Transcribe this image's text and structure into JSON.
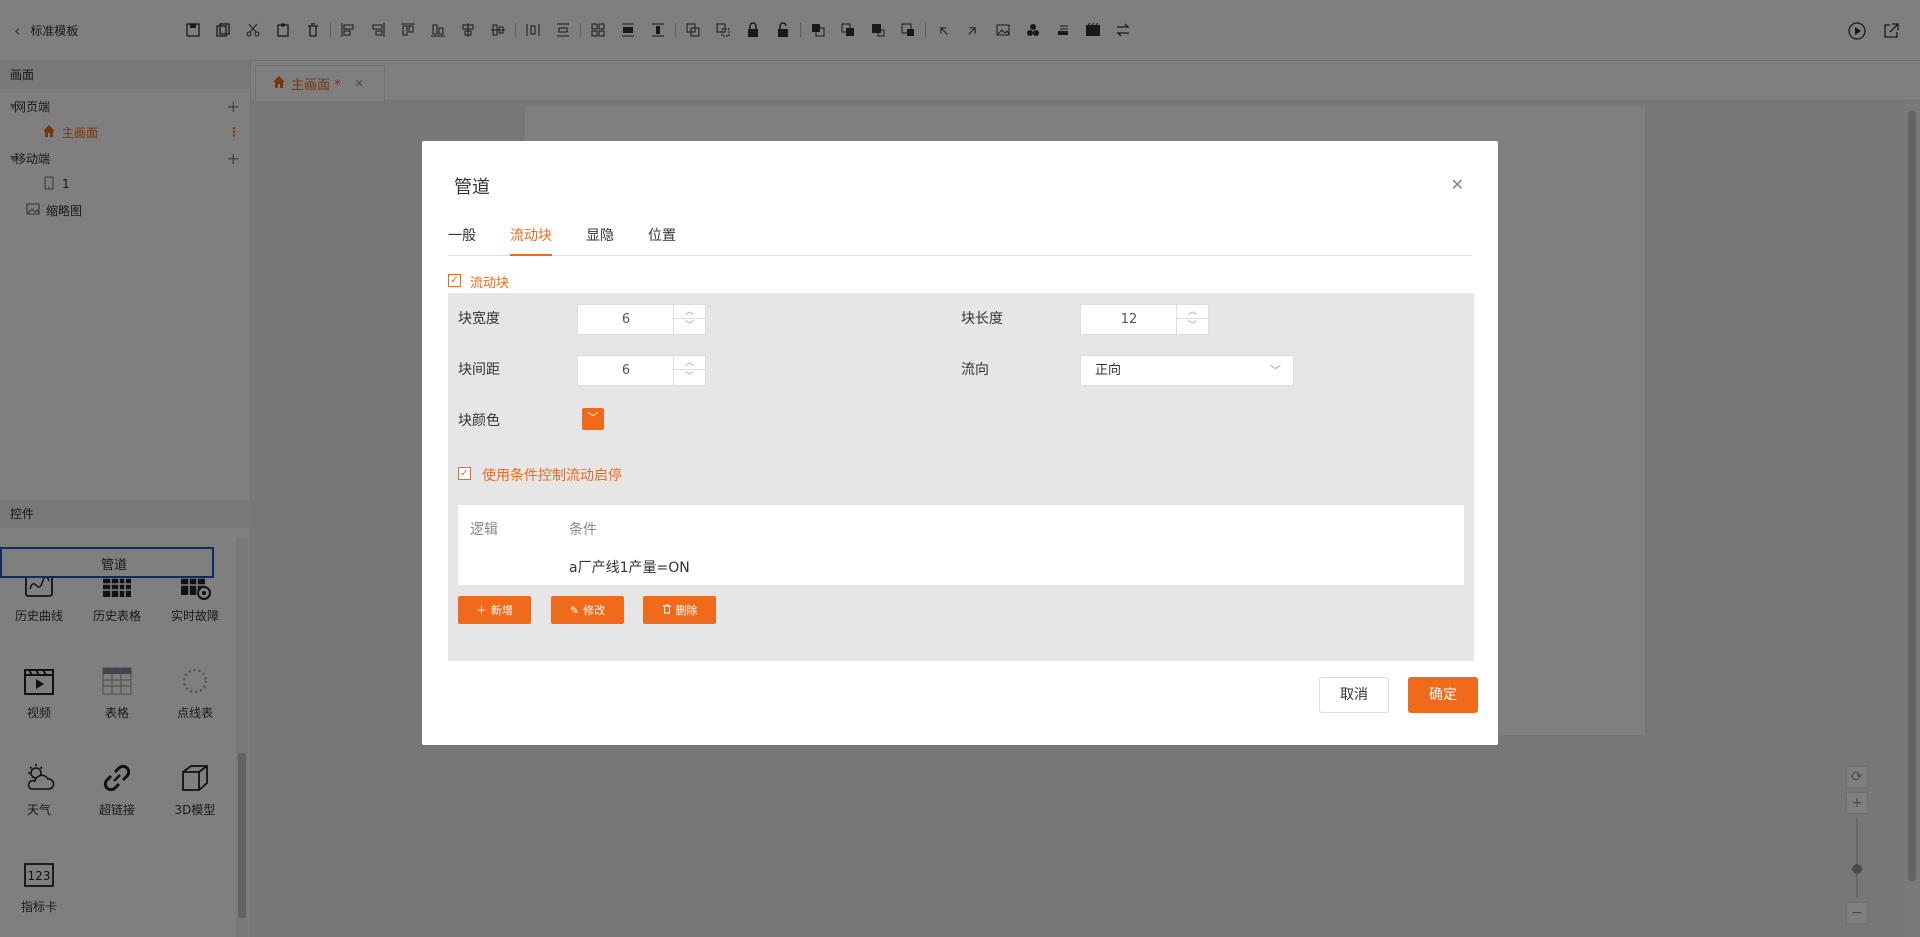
{
  "app": {
    "back_title": "标准模板"
  },
  "colors": {
    "accent": "#f06a1c",
    "selection_border": "#1e5bb8"
  },
  "left_panel": {
    "screens_header": "画面",
    "tree": {
      "web": "网页端",
      "home": "主画面",
      "mobile": "移动端",
      "mobile_item": "1",
      "thumbnail": "缩略图"
    },
    "controls_header": "控件",
    "controls": [
      {
        "label": "管道",
        "icon": "pipe-icon"
      },
      {
        "label": "历史曲线",
        "icon": "history-curve-icon"
      },
      {
        "label": "历史表格",
        "icon": "history-table-icon"
      },
      {
        "label": "实时故障",
        "icon": "realtime-fault-icon"
      },
      {
        "label": "视频",
        "icon": "video-icon"
      },
      {
        "label": "表格",
        "icon": "table-icon"
      },
      {
        "label": "点线表",
        "icon": "dotted-gauge-icon"
      },
      {
        "label": "天气",
        "icon": "weather-icon"
      },
      {
        "label": "超链接",
        "icon": "hyperlink-icon"
      },
      {
        "label": "3D模型",
        "icon": "cube-icon"
      },
      {
        "label": "指标卡",
        "icon": "indicator-card-icon"
      }
    ]
  },
  "editor_tab": {
    "label": "主画面 *"
  },
  "dialog": {
    "title": "管道",
    "tabs": [
      "一般",
      "流动块",
      "显隐",
      "位置"
    ],
    "active_tab": "流动块",
    "flow_block_checkbox": "流动块",
    "fields": {
      "block_width_label": "块宽度",
      "block_width_value": "6",
      "block_length_label": "块长度",
      "block_length_value": "12",
      "block_gap_label": "块间距",
      "block_gap_value": "6",
      "direction_label": "流向",
      "direction_value": "正向",
      "block_color_label": "块颜色"
    },
    "condition_checkbox": "使用条件控制流动启停",
    "condition_table": {
      "headers": [
        "逻辑",
        "条件"
      ],
      "rows": [
        {
          "logic": "",
          "condition": "a厂产线1产量=ON"
        }
      ]
    },
    "actions": {
      "add": "新增",
      "edit": "修改",
      "delete": "删除"
    },
    "cancel": "取消",
    "ok": "确定"
  }
}
